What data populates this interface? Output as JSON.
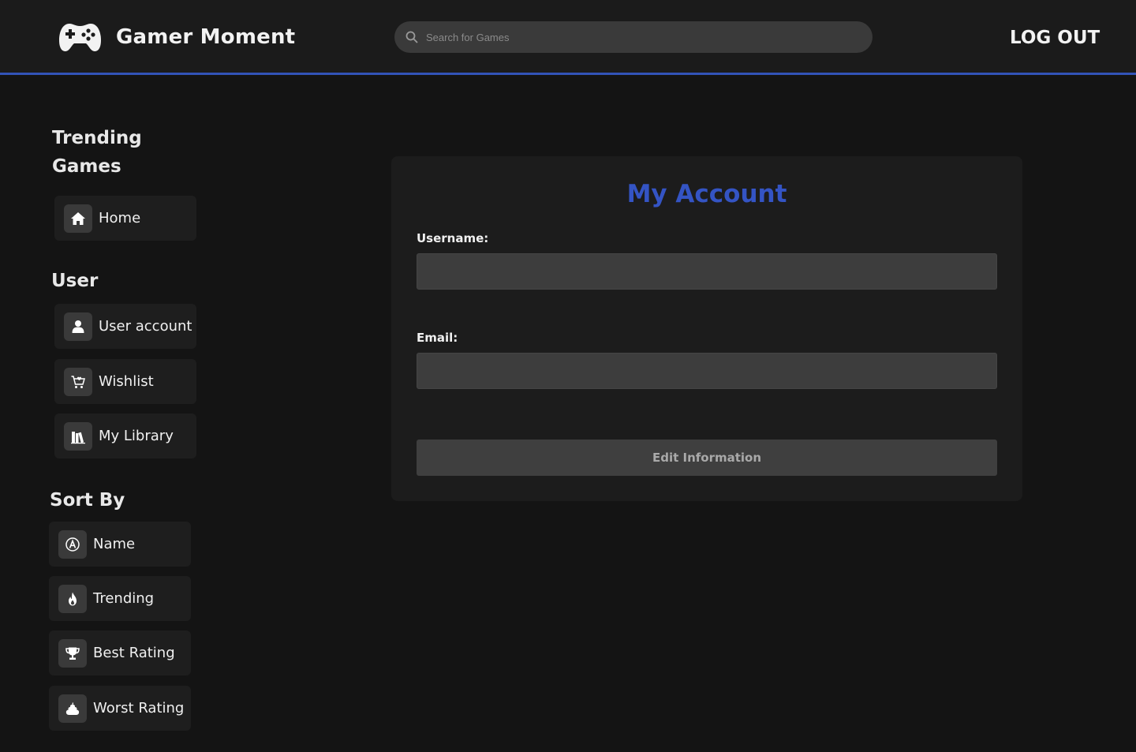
{
  "header": {
    "app_name": "Gamer Moment",
    "search_placeholder": "Search for Games",
    "search_value": "",
    "logout_label": "LOG OUT"
  },
  "sidebar": {
    "trending_heading": "Trending Games",
    "home": {
      "label": "Home",
      "icon": "home-icon"
    },
    "user_heading": "User",
    "user_items": [
      {
        "label": "User account",
        "icon": "user-icon"
      },
      {
        "label": "Wishlist",
        "icon": "cart-icon"
      },
      {
        "label": "My Library",
        "icon": "library-icon"
      }
    ],
    "sort_heading": "Sort By",
    "sort_items": [
      {
        "label": "Name",
        "icon": "letter-a-icon"
      },
      {
        "label": "Trending",
        "icon": "fire-icon"
      },
      {
        "label": "Best Rating",
        "icon": "trophy-icon"
      },
      {
        "label": "Worst Rating",
        "icon": "poop-icon"
      }
    ]
  },
  "account": {
    "title": "My Account",
    "username_label": "Username:",
    "username_value": "",
    "email_label": "Email:",
    "email_value": "",
    "edit_button_label": "Edit Information"
  },
  "colors": {
    "accent": "#3454c4",
    "header_border": "#3253b8",
    "background": "#141414",
    "card": "#1c1c1c"
  }
}
